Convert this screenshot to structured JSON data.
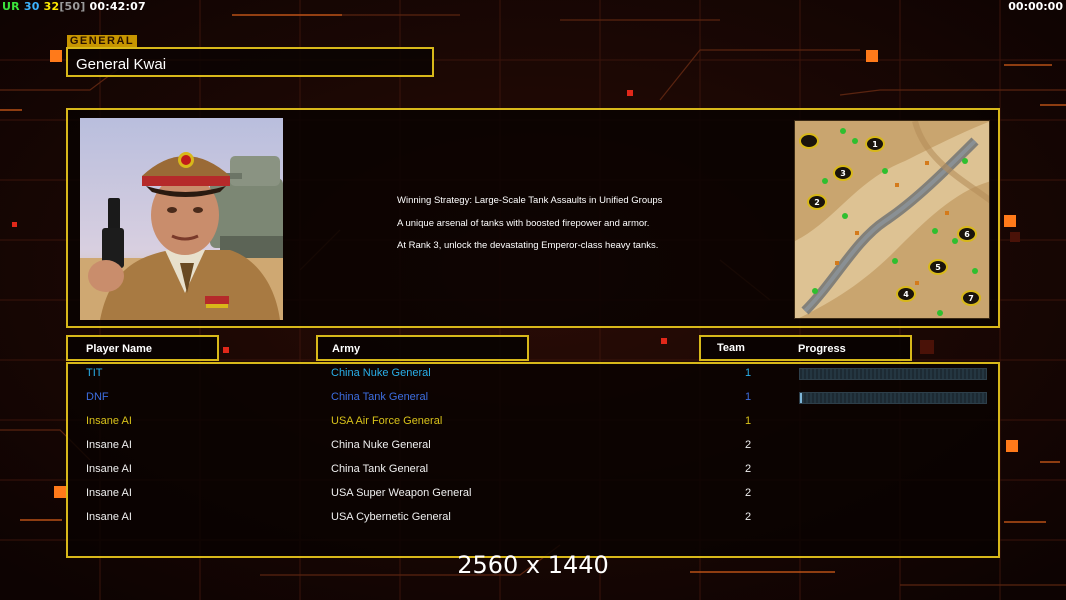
{
  "hud": {
    "seg1": "UR",
    "seg2": "30",
    "seg3": "32",
    "seg4": "[50]",
    "clock": "00:42:07",
    "timer": "00:00:00",
    "colors": {
      "seg1": "#3ce63c",
      "seg2": "#3db4ff",
      "seg3": "#ffe800",
      "seg4": "#9a9a9a",
      "clock": "#ffffff"
    }
  },
  "general": {
    "section_label": "GENERAL",
    "name": "General Kwai",
    "portrait_icon": "general-portrait-image",
    "map_icon": "map-preview-image"
  },
  "strategy": {
    "lines": [
      "Winning Strategy: Large-Scale Tank Assaults in Unified Groups",
      "A unique arsenal of tanks with boosted firepower and armor.",
      "At Rank 3, unlock the devastating Emperor-class heavy tanks."
    ]
  },
  "map": {
    "start_positions": [
      "1",
      "2",
      "3",
      "4",
      "5",
      "6",
      "7"
    ]
  },
  "table": {
    "headers": {
      "player": "Player Name",
      "army": "Army",
      "team": "Team",
      "progress": "Progress"
    },
    "rows": [
      {
        "name": "TIT",
        "army": "China Nuke General",
        "team": "1",
        "color": "#29aee8",
        "progress": 0.0,
        "show_progress": true
      },
      {
        "name": "DNF",
        "army": "China Tank General",
        "team": "1",
        "color": "#3d6ee0",
        "progress": 0.01,
        "show_progress": true
      },
      {
        "name": "Insane AI",
        "army": "USA Air Force General",
        "team": "1",
        "color": "#d8c21a",
        "show_progress": false
      },
      {
        "name": "Insane AI",
        "army": "China Nuke General",
        "team": "2",
        "color": "#f0f0f0",
        "show_progress": false
      },
      {
        "name": "Insane AI",
        "army": "China Tank General",
        "team": "2",
        "color": "#f0f0f0",
        "show_progress": false
      },
      {
        "name": "Insane AI",
        "army": "USA Super Weapon General",
        "team": "2",
        "color": "#f0f0f0",
        "show_progress": false
      },
      {
        "name": "Insane AI",
        "army": "USA Cybernetic General",
        "team": "2",
        "color": "#f0f0f0",
        "show_progress": false
      }
    ]
  },
  "footer": {
    "resolution": "2560 x 1440"
  },
  "theme": {
    "accent": "#d8b81a",
    "background": "#140604",
    "orange": "#ff7a1a"
  }
}
